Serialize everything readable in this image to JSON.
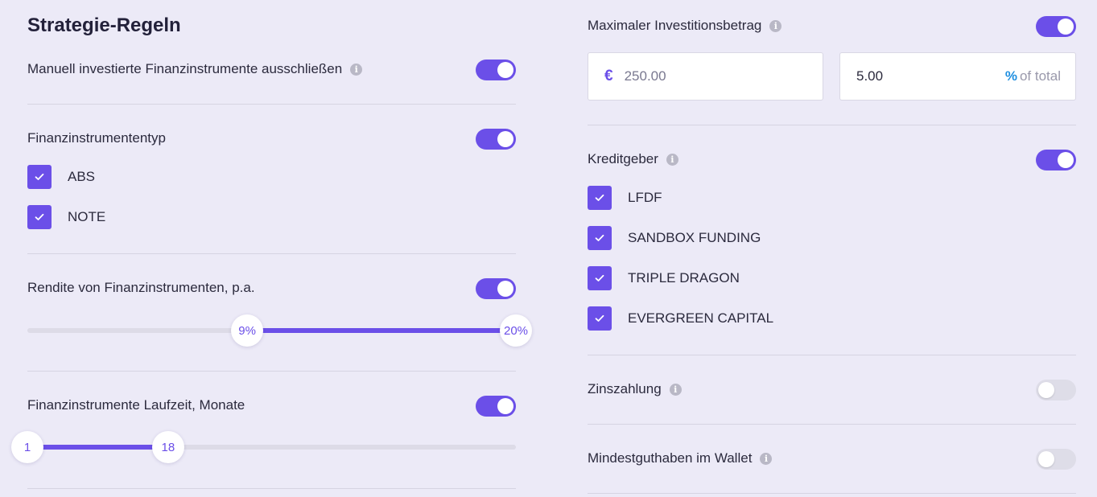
{
  "left": {
    "title": "Strategie-Regeln",
    "exclude_manual": {
      "label": "Manuell investierte Finanzinstrumente ausschließen",
      "enabled": true
    },
    "instrument_type": {
      "label": "Finanzinstrumententyp",
      "enabled": true,
      "options": [
        {
          "label": "ABS",
          "checked": true
        },
        {
          "label": "NOTE",
          "checked": true
        }
      ]
    },
    "yield": {
      "label": "Rendite von Finanzinstrumenten, p.a.",
      "enabled": true,
      "min_label": "9%",
      "max_label": "20%",
      "range_min": 0,
      "range_max": 20,
      "low": 9,
      "high": 20
    },
    "term": {
      "label": "Finanzinstrumente Laufzeit, Monate",
      "enabled": true,
      "min_label": "1",
      "max_label": "18",
      "range_min": 1,
      "range_max": 60,
      "low": 1,
      "high": 18
    }
  },
  "right": {
    "max_investment": {
      "label": "Maximaler Investitionsbetrag",
      "enabled": true,
      "currency_symbol": "€",
      "amount": "250.00",
      "percent": "5.00",
      "percent_symbol": "%",
      "percent_suffix": "of total"
    },
    "lenders": {
      "label": "Kreditgeber",
      "enabled": true,
      "options": [
        {
          "label": "LFDF",
          "checked": true
        },
        {
          "label": "SANDBOX FUNDING",
          "checked": true
        },
        {
          "label": "TRIPLE DRAGON",
          "checked": true
        },
        {
          "label": "EVERGREEN CAPITAL",
          "checked": true
        }
      ]
    },
    "interest_payment": {
      "label": "Zinszahlung",
      "enabled": false
    },
    "min_wallet": {
      "label": "Mindestguthaben im Wallet",
      "enabled": false
    }
  },
  "colors": {
    "accent": "#6b4fe8",
    "background": "#eceaf7",
    "info_icon": "#b9b8c6",
    "percent_blue": "#1f8fe0"
  },
  "icons": {
    "info": "info-icon",
    "check": "check-icon",
    "euro": "euro-icon"
  }
}
